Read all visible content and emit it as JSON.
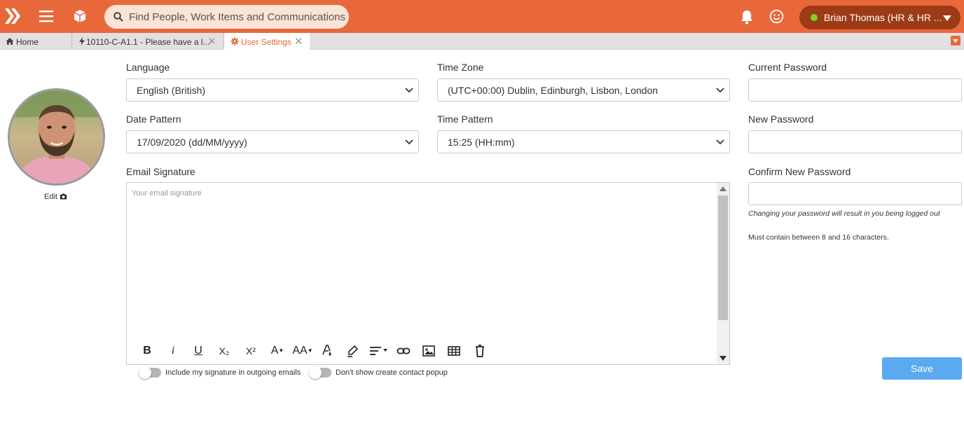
{
  "header": {
    "search_placeholder": "Find People, Work Items and Communications",
    "user_name": "Brian Thomas (HR & HR ...",
    "colors": {
      "bar": "#e8683b",
      "user_pill": "#9c3b16",
      "status_online": "#7ed321"
    }
  },
  "tabs": [
    {
      "label": "Home",
      "icon": "home-icon"
    },
    {
      "label": "10110-C-A1.1 - Please have a l...",
      "icon": "bolt-icon",
      "closable": true
    },
    {
      "label": "User Settings",
      "icon": "gear-icon",
      "closable": true,
      "active": true
    }
  ],
  "profile": {
    "edit_label": "Edit"
  },
  "form": {
    "language": {
      "label": "Language",
      "value": "English (British)"
    },
    "time_zone": {
      "label": "Time Zone",
      "value": "(UTC+00:00) Dublin, Edinburgh, Lisbon, London"
    },
    "date_pattern": {
      "label": "Date Pattern",
      "value": "17/09/2020 (dd/MM/yyyy)"
    },
    "time_pattern": {
      "label": "Time Pattern",
      "value": "15:25 (HH:mm)"
    },
    "email_signature": {
      "label": "Email Signature",
      "placeholder": "Your email signature"
    },
    "current_password": {
      "label": "Current Password"
    },
    "new_password": {
      "label": "New Password"
    },
    "confirm_password": {
      "label": "Confirm New Password"
    },
    "password_logout_note": "Changing your password will result in you being logged out",
    "password_rule_note": "Must contain between 8 and 16 characters.",
    "toggle_signature": "Include my signature in outgoing emails",
    "toggle_contact_popup": "Don't show create contact popup",
    "save_label": "Save"
  },
  "editor_toolbar": {
    "bold": "B",
    "italic": "i",
    "underline": "U",
    "subscript": "X₂",
    "superscript": "X²",
    "font_color": "A",
    "font_size": "AA"
  }
}
